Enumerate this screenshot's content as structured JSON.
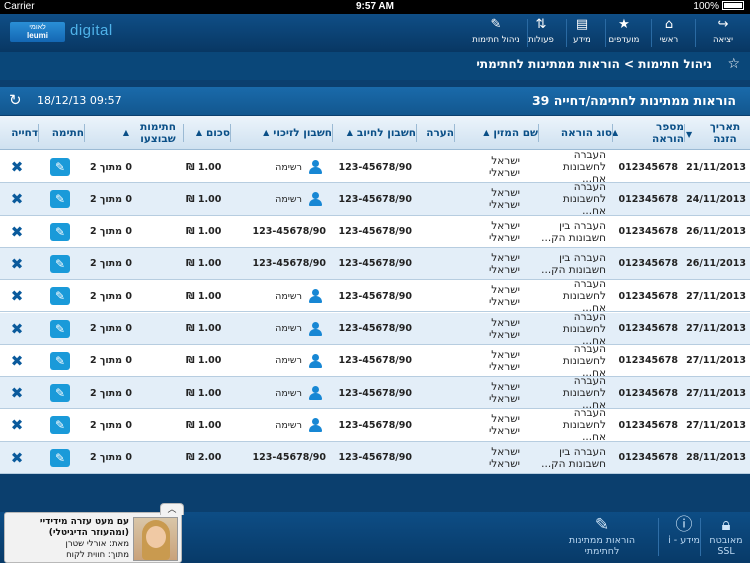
{
  "status_bar": {
    "carrier": "Carrier",
    "time": "9:57 AM",
    "battery": "100%"
  },
  "header": {
    "brand_logo_text_1": "לאומי",
    "brand_logo_text_2": "leumi",
    "brand": "digital",
    "nav": [
      {
        "label": "יציאה",
        "icon": "exit-arrow-icon"
      },
      {
        "label": "ראשי",
        "icon": "home-icon"
      },
      {
        "label": "מועדפים",
        "icon": "star-icon"
      },
      {
        "label": "מידע",
        "icon": "document-icon"
      },
      {
        "label": "פעולות",
        "icon": "transfer-arrows-icon"
      },
      {
        "label": "ניהול חתימות",
        "icon": "pen-icon"
      }
    ]
  },
  "breadcrumb": {
    "text": "ניהול חתימות > הוראות ממתינות לחתימתי"
  },
  "summary": {
    "count_text": "39 הוראות ממתינות לחתימה/דחייה",
    "datetime": "18/12/13 09:57"
  },
  "table": {
    "headers": {
      "date": "תאריך הזנה",
      "instruction_no": "מספר הוראה",
      "instruction_type": "סוג הוראה",
      "entered_by": "שם המזין",
      "note": "הערה",
      "debit_account": "חשבון לחיוב",
      "credit_account": "חשבון לזיכוי",
      "amount": "סכום",
      "signatures_done": "חתימות שבוצעו",
      "sign": "חתימה",
      "reject": "דחייה"
    },
    "rows": [
      {
        "date": "21/11/2013",
        "no": "012345678",
        "type_1": "העברה",
        "type_2": "לחשבונות אח...",
        "entered_1": "ישראל",
        "entered_2": "ישראלי",
        "debit": "123-45678/90",
        "credit": "רשימה",
        "credit_is_list": true,
        "amount": "1.00 ₪",
        "signed": "0 מתוך 2"
      },
      {
        "date": "24/11/2013",
        "no": "012345678",
        "type_1": "העברה",
        "type_2": "לחשבונות אח...",
        "entered_1": "ישראל",
        "entered_2": "ישראלי",
        "debit": "123-45678/90",
        "credit": "רשימה",
        "credit_is_list": true,
        "amount": "1.00 ₪",
        "signed": "0 מתוך 2"
      },
      {
        "date": "26/11/2013",
        "no": "012345678",
        "type_1": "העברה בין",
        "type_2": "חשבונות הק...",
        "entered_1": "ישראל",
        "entered_2": "ישראלי",
        "debit": "123-45678/90",
        "credit": "123-45678/90",
        "credit_is_list": false,
        "amount": "1.00 ₪",
        "signed": "0 מתוך 2"
      },
      {
        "date": "26/11/2013",
        "no": "012345678",
        "type_1": "העברה בין",
        "type_2": "חשבונות הק...",
        "entered_1": "ישראל",
        "entered_2": "ישראלי",
        "debit": "123-45678/90",
        "credit": "123-45678/90",
        "credit_is_list": false,
        "amount": "1.00 ₪",
        "signed": "0 מתוך 2"
      },
      {
        "date": "27/11/2013",
        "no": "012345678",
        "type_1": "העברה",
        "type_2": "לחשבונות אח...",
        "entered_1": "ישראל",
        "entered_2": "ישראלי",
        "debit": "123-45678/90",
        "credit": "רשימה",
        "credit_is_list": true,
        "amount": "1.00 ₪",
        "signed": "0 מתוך 2"
      },
      {
        "date": "27/11/2013",
        "no": "012345678",
        "type_1": "העברה",
        "type_2": "לחשבונות אח...",
        "entered_1": "ישראל",
        "entered_2": "ישראלי",
        "debit": "123-45678/90",
        "credit": "רשימה",
        "credit_is_list": true,
        "amount": "1.00 ₪",
        "signed": "0 מתוך 2"
      },
      {
        "date": "27/11/2013",
        "no": "012345678",
        "type_1": "העברה",
        "type_2": "לחשבונות אח...",
        "entered_1": "ישראל",
        "entered_2": "ישראלי",
        "debit": "123-45678/90",
        "credit": "רשימה",
        "credit_is_list": true,
        "amount": "1.00 ₪",
        "signed": "0 מתוך 2"
      },
      {
        "date": "27/11/2013",
        "no": "012345678",
        "type_1": "העברה",
        "type_2": "לחשבונות אח...",
        "entered_1": "ישראל",
        "entered_2": "ישראלי",
        "debit": "123-45678/90",
        "credit": "רשימה",
        "credit_is_list": true,
        "amount": "1.00 ₪",
        "signed": "0 מתוך 2"
      },
      {
        "date": "27/11/2013",
        "no": "012345678",
        "type_1": "העברה",
        "type_2": "לחשבונות אח...",
        "entered_1": "ישראל",
        "entered_2": "ישראלי",
        "debit": "123-45678/90",
        "credit": "רשימה",
        "credit_is_list": true,
        "amount": "1.00 ₪",
        "signed": "0 מתוך 2"
      },
      {
        "date": "28/11/2013",
        "no": "012345678",
        "type_1": "העברה בין",
        "type_2": "חשבונות הק...",
        "entered_1": "ישראל",
        "entered_2": "ישראלי",
        "debit": "123-45678/90",
        "credit": "123-45678/90",
        "credit_is_list": false,
        "amount": "2.00 ₪",
        "signed": "0 מתוך 2"
      }
    ]
  },
  "bottom": {
    "items": [
      {
        "label_1": "מאובטח",
        "label_2": "SSL",
        "icon": "lock-icon"
      },
      {
        "label_1": "i - מידע",
        "label_2": "",
        "icon": "info-icon"
      },
      {
        "label_1": "הוראות ממתינות",
        "label_2": "לחתימתי",
        "icon": "pending-sign-icon"
      }
    ],
    "advisor": {
      "title": "עם מעט עזרה מידידיי",
      "subtitle": "(ומהעוזר הדיגיטלי)",
      "by": "מאת: אורלי שטרן",
      "from": "מתוך: חווית לקוח"
    }
  },
  "colors": {
    "accent": "#1a9ad9",
    "header_blue": "#0a4779",
    "row_alt": "#e3eef8"
  }
}
